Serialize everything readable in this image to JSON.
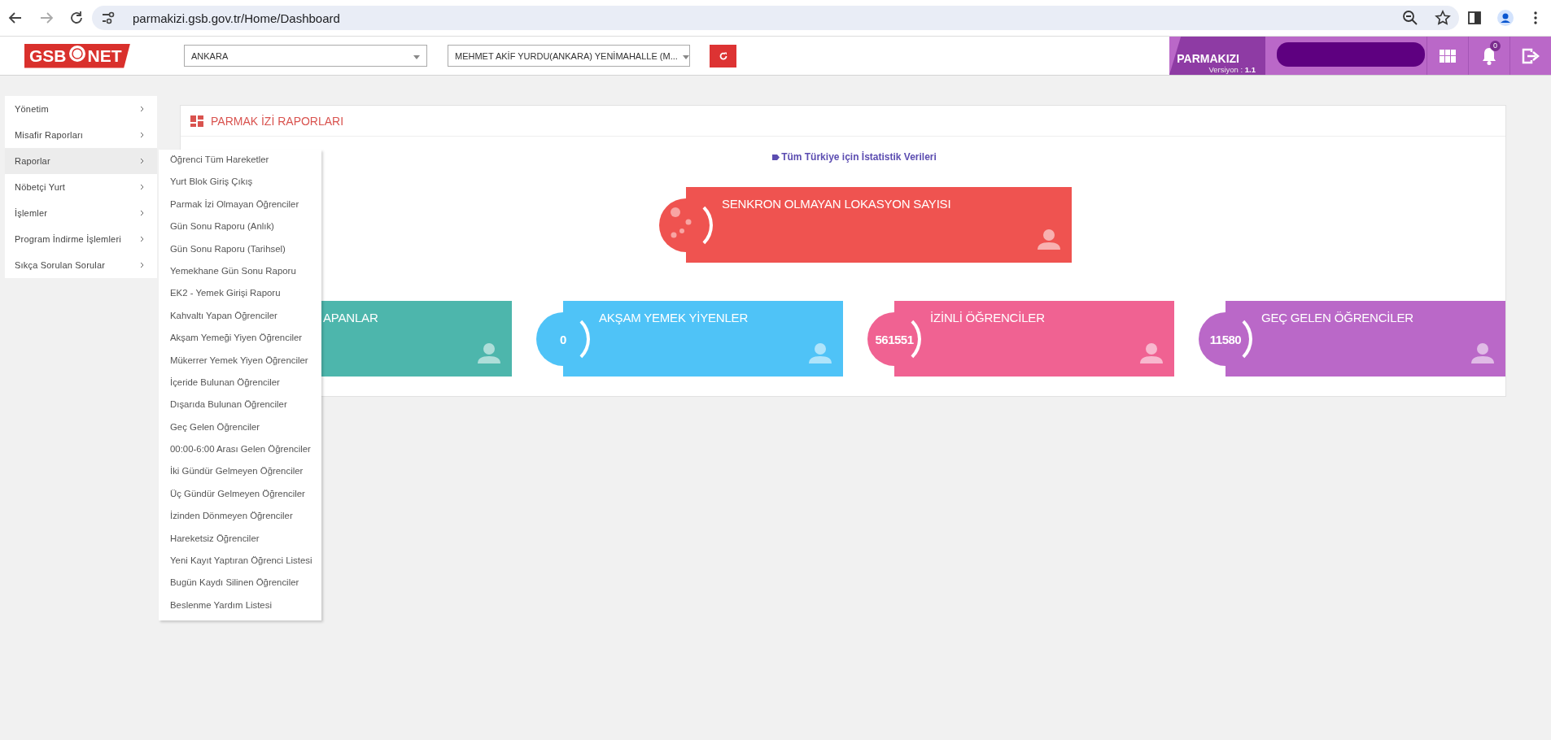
{
  "browser": {
    "url": "parmakizi.gsb.gov.tr/Home/Dashboard"
  },
  "header": {
    "logo_left": "GSB",
    "logo_right": "NET",
    "selects": [
      {
        "value": "ANKARA"
      },
      {
        "value": "MEHMET AKİF YURDU(ANKARA) YENİMAHALLE (M..."
      }
    ],
    "brand": "PARMAKIZI",
    "version_label": "Versiyon :",
    "version": "1.1",
    "notification_count": "0"
  },
  "sidebar": {
    "items": [
      {
        "label": "Yönetim",
        "selected": false
      },
      {
        "label": "Misafir Raporları",
        "selected": false
      },
      {
        "label": "Raporlar",
        "selected": true
      },
      {
        "label": "Nöbetçi Yurt",
        "selected": false
      },
      {
        "label": "İşlemler",
        "selected": false
      },
      {
        "label": "Program İndirme İşlemleri",
        "selected": false
      },
      {
        "label": "Sıkça Sorulan Sorular",
        "selected": false
      }
    ]
  },
  "submenu": {
    "items": [
      "Öğrenci Tüm Hareketler",
      "Yurt Blok Giriş Çıkış",
      "Parmak İzi Olmayan Öğrenciler",
      "Gün Sonu Raporu (Anlık)",
      "Gün Sonu Raporu (Tarihsel)",
      "Yemekhane Gün Sonu Raporu",
      "EK2 - Yemek Girişi Raporu",
      "Kahvaltı Yapan Öğrenciler",
      "Akşam Yemeği Yiyen Öğrenciler",
      "Mükerrer Yemek Yiyen Öğrenciler",
      "İçeride Bulunan Öğrenciler",
      "Dışarıda Bulunan Öğrenciler",
      "Geç Gelen Öğrenciler",
      "00:00-6:00 Arası Gelen Öğrenciler",
      "İki Gündür Gelmeyen Öğrenciler",
      "Üç Gündür Gelmeyen Öğrenciler",
      "İzinden Dönmeyen Öğrenciler",
      "Hareketsiz Öğrenciler",
      "Yeni Kayıt Yaptıran Öğrenci Listesi",
      "Bugün Kaydı Silinen Öğrenciler",
      "Beslenme Yardım Listesi"
    ]
  },
  "panel": {
    "title": "PARMAK İZİ RAPORLARI",
    "link": "Tüm Türkiye için İstatistik Verileri",
    "top_card": {
      "kind": "bubbles",
      "title": "SENKRON OLMAYAN LOKASYON SAYISI",
      "color": "#ef5350"
    },
    "cards": [
      {
        "kind": "number",
        "title": "APANLAR",
        "color": "#4db6ac"
      },
      {
        "kind": "number",
        "title": "AKŞAM YEMEK YİYENLER",
        "value": "0",
        "color": "#4fc3f7"
      },
      {
        "kind": "number",
        "title": "İZİNLİ ÖĞRENCİLER",
        "value": "561551",
        "color": "#f06292"
      },
      {
        "kind": "number",
        "title": "GEÇ GELEN ÖĞRENCİLER",
        "value": "11580",
        "color": "#ba68c8"
      }
    ]
  }
}
